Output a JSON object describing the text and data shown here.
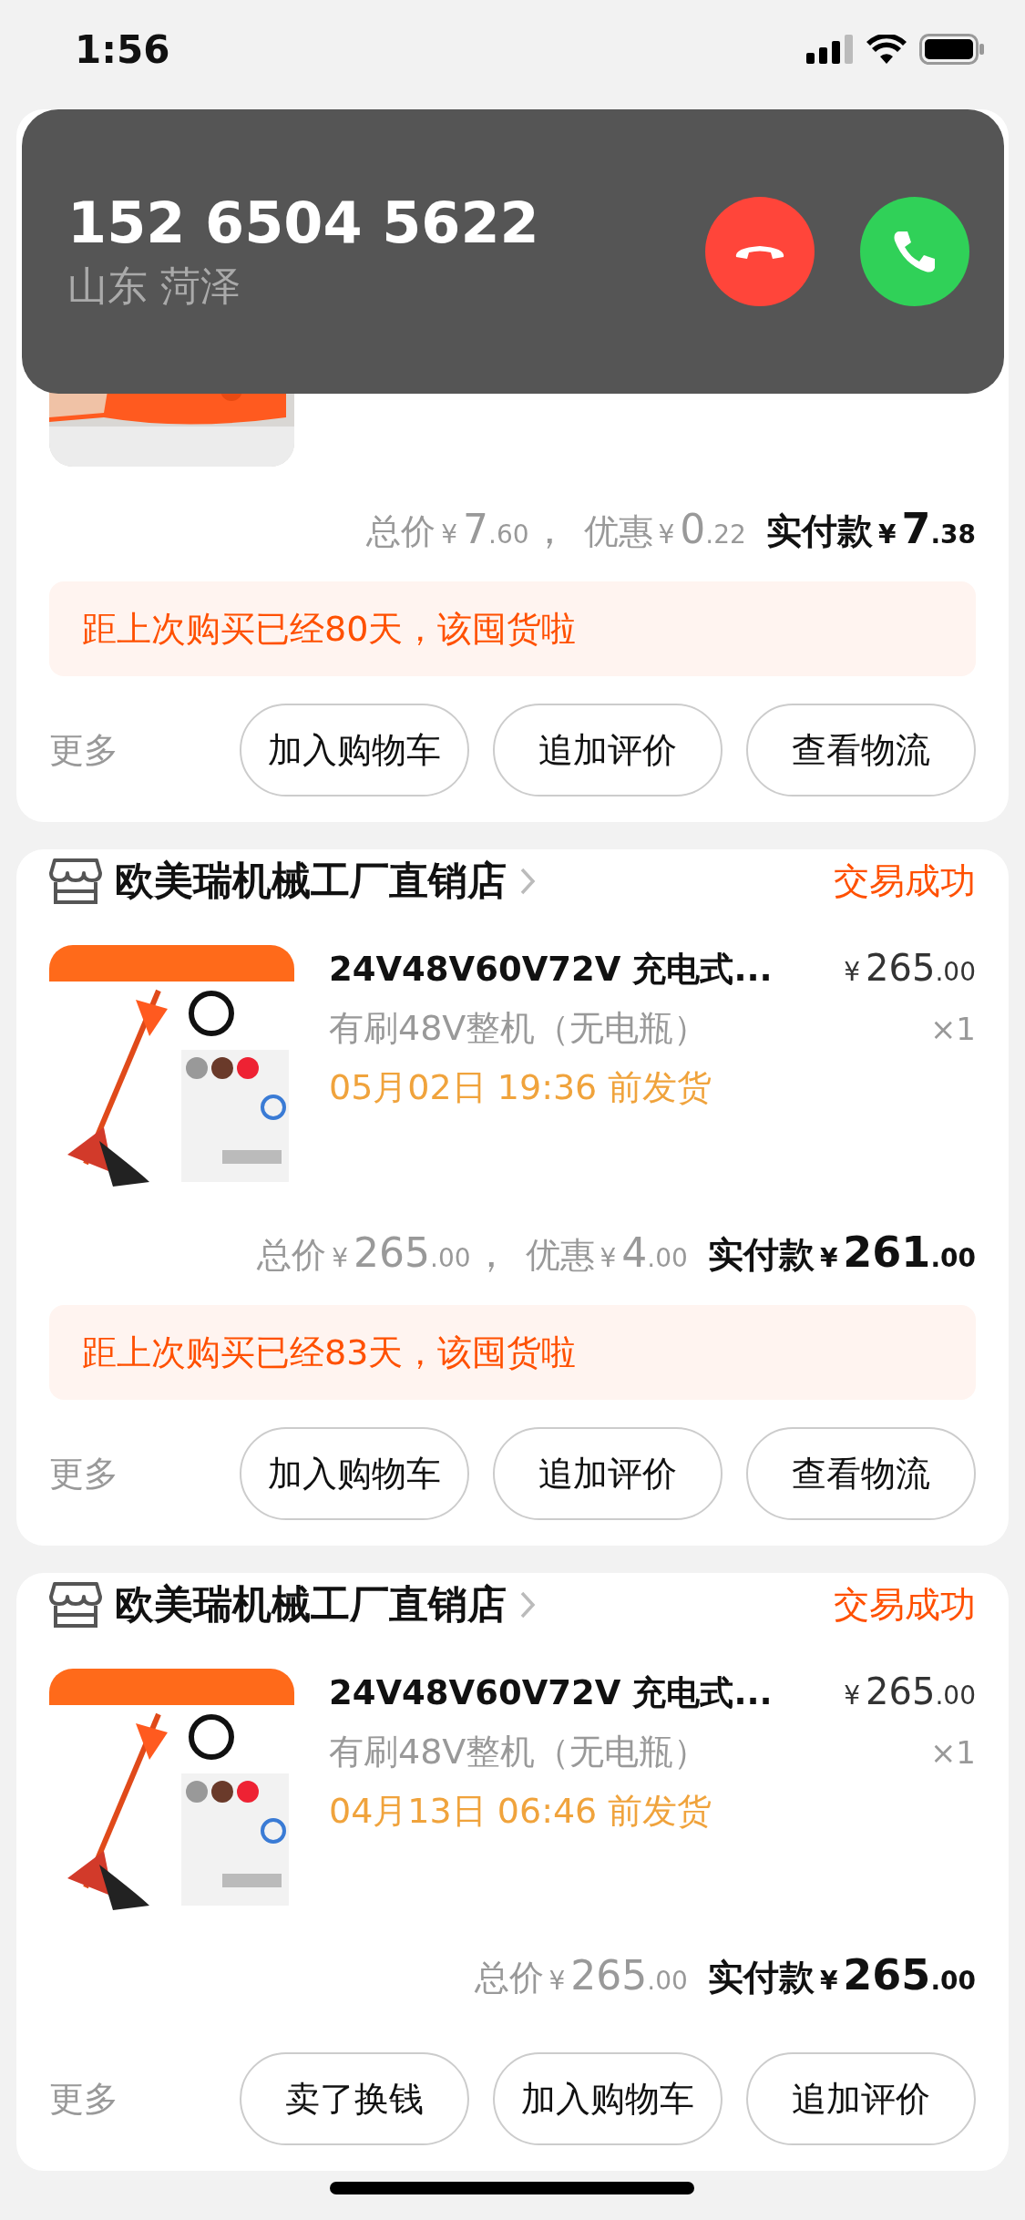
{
  "status_bar": {
    "time": "1:56"
  },
  "call": {
    "number": "152 6504 5622",
    "location": "山东 菏泽"
  },
  "orders": [
    {
      "product": {
        "kind": "picture"
      },
      "totals": [
        {
          "label": "总价",
          "yen": "¥",
          "int": "7",
          "dec": ".60",
          "sep": "，"
        },
        {
          "label": "优惠",
          "yen": "¥",
          "int": "0",
          "dec": ".22"
        }
      ],
      "paid": {
        "label": "实付款",
        "yen": "¥",
        "int": "7",
        "dec": ".38"
      },
      "notice": "距上次购买已经80天，该囤货啦",
      "more": "更多",
      "buttons": [
        "加入购物车",
        "追加评价",
        "查看物流"
      ]
    },
    {
      "store": "欧美瑞机械工厂直销店",
      "status": "交易成功",
      "product": {
        "kind": "picture",
        "title": "24V48V60V72V 充电式...",
        "sku": "有刷48V整机（无电瓶）",
        "ship": "05月02日 19:36 前发货",
        "yen": "¥",
        "int": "265",
        "dec": ".00",
        "qty": "×1"
      },
      "totals": [
        {
          "label": "总价",
          "yen": "¥",
          "int": "265",
          "dec": ".00",
          "sep": "，"
        },
        {
          "label": "优惠",
          "yen": "¥",
          "int": "4",
          "dec": ".00"
        }
      ],
      "paid": {
        "label": "实付款",
        "yen": "¥",
        "int": "261",
        "dec": ".00"
      },
      "notice": "距上次购买已经83天，该囤货啦",
      "more": "更多",
      "buttons": [
        "加入购物车",
        "追加评价",
        "查看物流"
      ]
    },
    {
      "store": "欧美瑞机械工厂直销店",
      "status": "交易成功",
      "product": {
        "kind": "picture",
        "title": "24V48V60V72V 充电式...",
        "sku": "有刷48V整机（无电瓶）",
        "ship": "04月13日 06:46 前发货",
        "yen": "¥",
        "int": "265",
        "dec": ".00",
        "qty": "×1"
      },
      "totals": [
        {
          "label": "总价",
          "yen": "¥",
          "int": "265",
          "dec": ".00"
        }
      ],
      "paid": {
        "label": "实付款",
        "yen": "¥",
        "int": "265",
        "dec": ".00"
      },
      "more": "更多",
      "buttons": [
        "卖了换钱",
        "加入购物车",
        "追加评价"
      ]
    }
  ]
}
